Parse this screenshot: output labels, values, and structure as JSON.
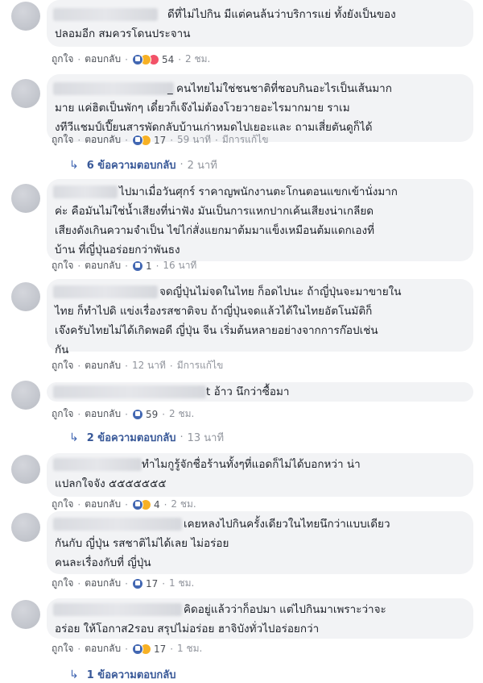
{
  "labels": {
    "like": "ถูกใจ",
    "reply": "ตอบกลับ"
  },
  "comments": [
    {
      "lines": [
        "ดีที่ไม่ไปกิน มีแต่คนล้นว่าบริการแย่ ทั้งยังเป็นของ",
        "ปลอมอีก สมควรโดนประจาน"
      ],
      "count": "54",
      "time": "2 ชม.",
      "edited": "",
      "reactions": [
        "like-icon",
        "haha-icon",
        "love-icon"
      ]
    },
    {
      "lines": [
        "_ คนไทยไม่ใช่ชนชาติที่ชอบกินอะไรเป็นเส้นมาก",
        "มาย แค่ฮิตเป็นพักๆ เดี๋ยวก็เจ๊งไม่ต้องโวยวายอะไรมากมาย ราเม",
        "งทีวีแชมป์เปี๊ยนสารพัดกลับบ้านเก่าหมดไปเยอะและ ถามเสี่ยตันดูก็ได้"
      ],
      "count": "17",
      "time": "59 นาที",
      "edited": "มีการแก้ไข",
      "reactions": [
        "like-icon",
        "haha-icon"
      ],
      "replies": {
        "label": "6 ข้อความตอบกลับ",
        "time": "2 นาที"
      }
    },
    {
      "lines": [
        "ไปมาเมื่อวันศุกร์ ราคาญพนักงานตะโกนตอนแขกเข้านั่งมาก",
        "ค่ะ คือมันไม่ใช่น้ำเสียงที่น่าฟัง มันเป็นการแหกปากเค้นเสียงน่าเกลียด",
        "เสียงดังเกินความจำเป็น ไข่ไก่สั่งแยกมาต้มมาแข็งเหมือนต้มแดกเองที่",
        "บ้าน ที่ญี่ปุ่นอร่อยกว่าพันธง"
      ],
      "count": "1",
      "time": "16 นาที",
      "edited": "",
      "reactions": [
        "like-icon"
      ]
    },
    {
      "lines": [
        "จดญี่ปุ่นไม่จดในไทย ก็อดไปนะ ถ้าญี่ปุ่นจะมาขายใน",
        "ไทย ก็ทำไปดิ แข่งเรื่องรสชาติจบ ถ้าญี่ปุ่นจดแล้วได้ในไทยอัตโนมัติก็",
        "เจ๊งครับไทยไม่ได้เกิดพอดี ญี่ปุ่น จีน เริ่มต้นหลายอย่างจากการก๊อปเช่น",
        "กัน"
      ],
      "count": "",
      "time": "12 นาที",
      "edited": "มีการแก้ไข",
      "reactions": []
    },
    {
      "lines": [
        "t อ้าว นึกว่าซื้อมา"
      ],
      "count": "59",
      "time": "2 ชม.",
      "edited": "",
      "reactions": [
        "like-icon"
      ],
      "replies": {
        "label": "2 ข้อความตอบกลับ",
        "time": "13 นาที"
      }
    },
    {
      "lines": [
        "ทำไมกูรู้จักชื่อร้านทั้งๆที่แอดก็ไม่ได้บอกหว่า น่า",
        "แปลกใจจัง ๕๕๕๕๕๕๕"
      ],
      "count": "4",
      "time": "2 ชม.",
      "edited": "",
      "reactions": [
        "like-icon",
        "haha-icon"
      ]
    },
    {
      "lines": [
        "เคยหลงไปกินครั้งเดียวในไทยนึกว่าแบบเดียว",
        "กันกับ ญี่ปุ่น รสชาติไม่ได้เลย ไม่อร่อย",
        "คนละเรื่องกับที่ ญี่ปุ่น"
      ],
      "count": "17",
      "time": "1 ชม.",
      "edited": "",
      "reactions": [
        "like-icon"
      ]
    },
    {
      "lines": [
        "คิดอยู่แล้วว่าก็อปมา แต่ไปกินมาเพราะว่าจะ",
        "อร่อย ให้โอกาส2รอบ สรุปไม่อร่อย ฮาจิบังทั่วไปอร่อยกว่า"
      ],
      "count": "17",
      "time": "1 ชม.",
      "edited": "",
      "reactions": [
        "like-icon",
        "haha-icon"
      ],
      "replies": {
        "label": "1 ข้อความตอบกลับ",
        "time": ""
      }
    }
  ]
}
